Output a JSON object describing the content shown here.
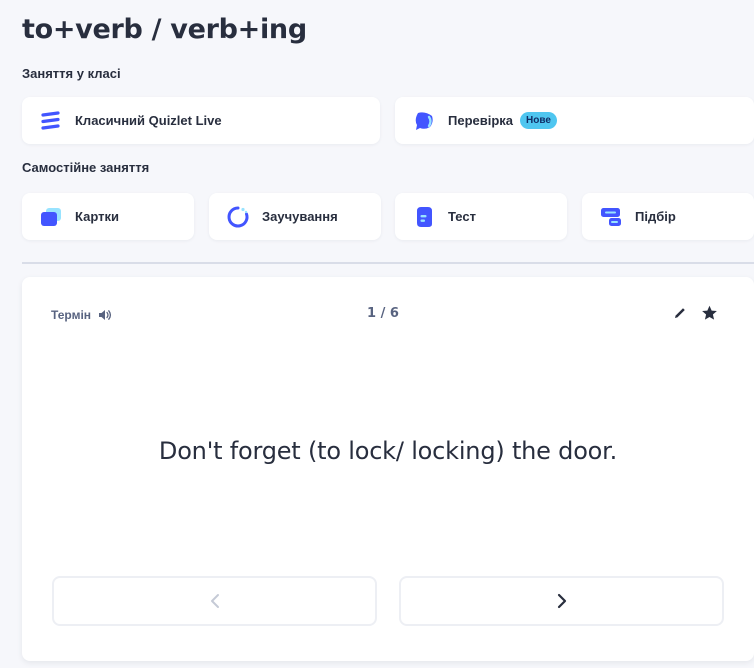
{
  "page": {
    "title": "to+verb / verb+ing"
  },
  "classroom": {
    "heading": "Заняття у класі",
    "modes": [
      {
        "label": "Класичний Quizlet Live",
        "icon": "quizlet-live-icon"
      },
      {
        "label": "Перевірка",
        "icon": "checkpoint-icon",
        "badge": "Нове"
      }
    ]
  },
  "self_study": {
    "heading": "Самостійне заняття",
    "modes": [
      {
        "label": "Картки",
        "icon": "flashcards-icon"
      },
      {
        "label": "Заучування",
        "icon": "learn-icon"
      },
      {
        "label": "Тест",
        "icon": "test-icon"
      },
      {
        "label": "Підбір",
        "icon": "match-icon"
      }
    ]
  },
  "flashcard": {
    "side_label": "Термін",
    "counter": "1 / 6",
    "term": "Don't forget (to lock/ locking) the door."
  },
  "colors": {
    "accent": "#4255ff",
    "badge": "#4fc6f0",
    "background": "#f6f7fb",
    "text": "#282e3e",
    "muted": "#586380"
  }
}
